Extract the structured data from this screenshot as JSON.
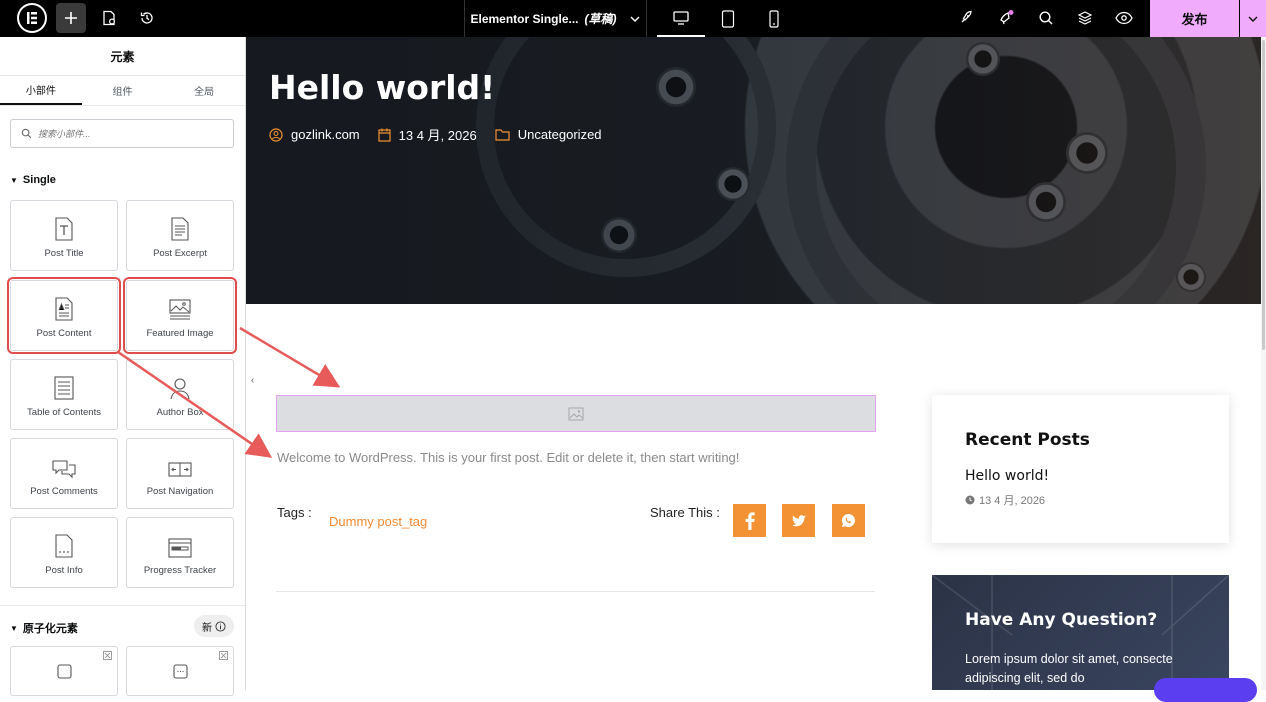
{
  "topbar": {
    "doc_title": "Elementor Single...",
    "doc_status": "(草稿)",
    "publish_label": "发布"
  },
  "sidebar": {
    "header": "元素",
    "tabs": [
      "小部件",
      "组件",
      "全局"
    ],
    "search_placeholder": "搜索小部件...",
    "section_single": "Single",
    "widgets": [
      "Post Title",
      "Post Excerpt",
      "Post Content",
      "Featured Image",
      "Table of Contents",
      "Author Box",
      "Post Comments",
      "Post Navigation",
      "Post Info",
      "Progress Tracker"
    ],
    "section_atomic": "原子化元素",
    "new_badge": "新"
  },
  "hero": {
    "title": "Hello world!",
    "author": "gozlink.com",
    "date": "13 4 月, 2026",
    "category": "Uncategorized"
  },
  "content": {
    "post_text": "Welcome to WordPress. This is your first post. Edit or delete it, then start writing!",
    "tags_label": "Tags :",
    "tag": "Dummy post_tag",
    "share_label": "Share This :"
  },
  "recent_posts": {
    "title": "Recent Posts",
    "post": "Hello world!",
    "date": "13 4 月, 2026"
  },
  "question": {
    "title": "Have Any Question?",
    "text": "Lorem ipsum dolor sit amet, consecte adipiscing elit, sed do"
  },
  "colors": {
    "accent_orange": "#f39234",
    "publish_pink": "#f0abfc",
    "highlight_red": "#e04b4b"
  }
}
